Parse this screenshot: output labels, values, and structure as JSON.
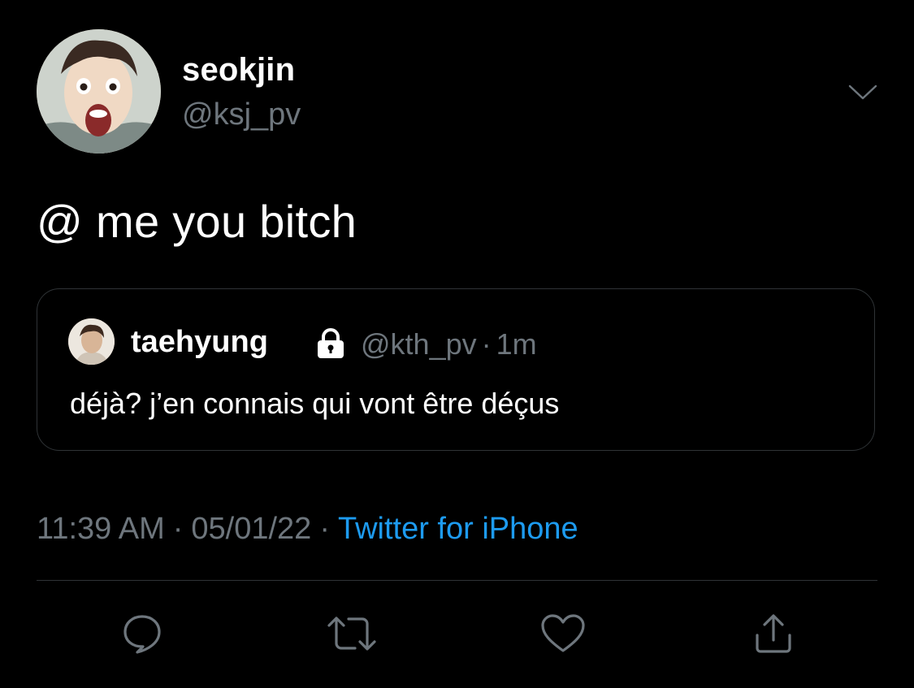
{
  "author": {
    "display_name": "seokjin",
    "handle": "@ksj_pv"
  },
  "tweet": {
    "text": "@ me you bitch"
  },
  "quoted_tweet": {
    "display_name": "taehyung",
    "handle": "@kth_pv",
    "separator": "·",
    "age": "1m",
    "text": "déjà? j’en connais qui vont être déçus",
    "locked": true
  },
  "meta": {
    "time": "11:39 AM",
    "separator": "·",
    "date": "05/01/22",
    "source": "Twitter for iPhone"
  },
  "icons": {
    "more": "chevron-down-icon",
    "lock": "lock-icon",
    "reply": "reply-bubble-icon",
    "retweet": "retweet-icon",
    "like": "heart-icon",
    "share": "share-icon"
  },
  "colors": {
    "background": "#000000",
    "text_primary": "#ffffff",
    "text_secondary": "#6e767d",
    "link": "#1d9bf0",
    "border": "#2f3336"
  }
}
